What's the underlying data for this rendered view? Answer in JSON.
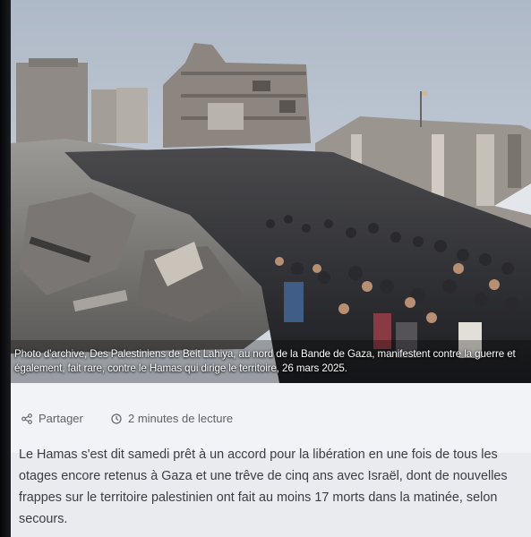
{
  "photo": {
    "caption": "Photo d'archive, Des Palestiniens de Beit Lahiya, au nord de la Bande de Gaza, manifestent contre la guerre et également, fait rare, contre le Hamas qui dirige le territoire, 26 mars 2025."
  },
  "meta": {
    "share_label": "Partager",
    "share_icon": "share-icon",
    "read_time": "2 minutes de lecture",
    "clock_icon": "clock-icon"
  },
  "article": {
    "body": "Le Hamas s'est dit samedi prêt à un accord pour la libération en une fois de tous les\notages encore retenus à Gaza et une trêve de cinq ans avec Israël, dont de nouvelles\nfrappes sur le territoire palestinien ont fait au moins 17 morts dans la matinée, selon\nsecours."
  },
  "colors": {
    "page_bg": "#e9ebef",
    "text": "#3a3d44",
    "meta_text": "#5d6169"
  }
}
